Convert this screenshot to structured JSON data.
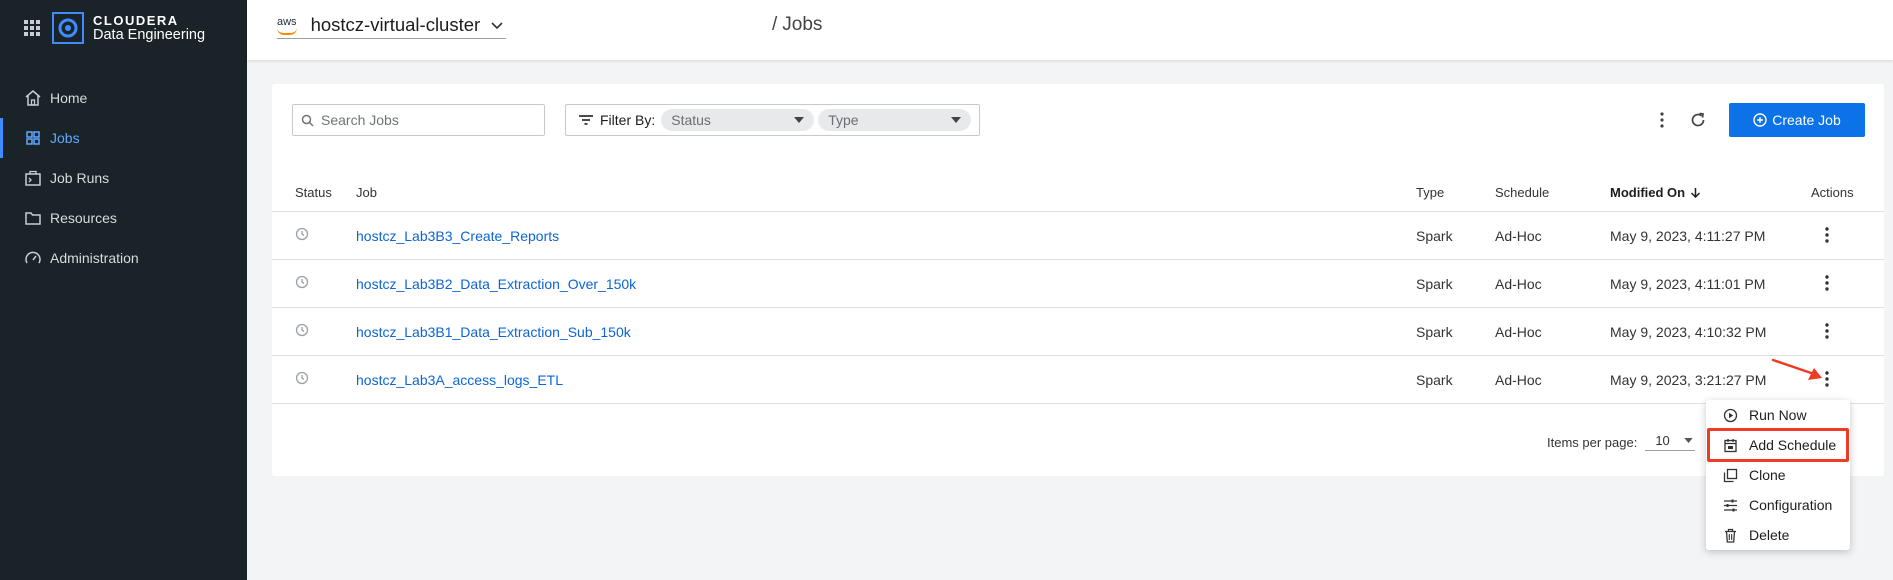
{
  "brand": {
    "line1": "CLOUDERA",
    "line2": "Data Engineering"
  },
  "sidebar": {
    "items": [
      {
        "label": "Home",
        "icon": "home-icon",
        "active": false
      },
      {
        "label": "Jobs",
        "icon": "jobs-grid-icon",
        "active": true
      },
      {
        "label": "Job Runs",
        "icon": "job-runs-icon",
        "active": false
      },
      {
        "label": "Resources",
        "icon": "folder-icon",
        "active": false
      },
      {
        "label": "Administration",
        "icon": "gauge-icon",
        "active": false
      }
    ]
  },
  "header": {
    "cloud_badge": "aws",
    "cluster": "hostcz-virtual-cluster",
    "separator": "/",
    "page": "Jobs"
  },
  "toolbar": {
    "search_placeholder": "Search Jobs",
    "filter_label": "Filter By:",
    "filter_status": "Status",
    "filter_type": "Type",
    "create_label": "Create Job"
  },
  "table": {
    "columns": {
      "status": "Status",
      "job": "Job",
      "type": "Type",
      "schedule": "Schedule",
      "modified": "Modified On",
      "actions": "Actions"
    },
    "rows": [
      {
        "job": "hostcz_Lab3B3_Create_Reports",
        "type": "Spark",
        "schedule": "Ad-Hoc",
        "modified": "May 9, 2023, 4:11:27 PM"
      },
      {
        "job": "hostcz_Lab3B2_Data_Extraction_Over_150k",
        "type": "Spark",
        "schedule": "Ad-Hoc",
        "modified": "May 9, 2023, 4:11:01 PM"
      },
      {
        "job": "hostcz_Lab3B1_Data_Extraction_Sub_150k",
        "type": "Spark",
        "schedule": "Ad-Hoc",
        "modified": "May 9, 2023, 4:10:32 PM"
      },
      {
        "job": "hostcz_Lab3A_access_logs_ETL",
        "type": "Spark",
        "schedule": "Ad-Hoc",
        "modified": "May 9, 2023, 3:21:27 PM"
      }
    ]
  },
  "pager": {
    "label": "Items per page:",
    "value": "10"
  },
  "menu": {
    "items": [
      {
        "label": "Run Now",
        "icon": "play-circle-icon"
      },
      {
        "label": "Add Schedule",
        "icon": "calendar-icon",
        "highlighted": true
      },
      {
        "label": "Clone",
        "icon": "copy-icon"
      },
      {
        "label": "Configuration",
        "icon": "sliders-icon"
      },
      {
        "label": "Delete",
        "icon": "trash-icon"
      }
    ]
  },
  "colors": {
    "sidebar": "#1a2328",
    "accent": "#0b72e7",
    "link": "#0b65d8",
    "annotation": "#ef3b24"
  }
}
